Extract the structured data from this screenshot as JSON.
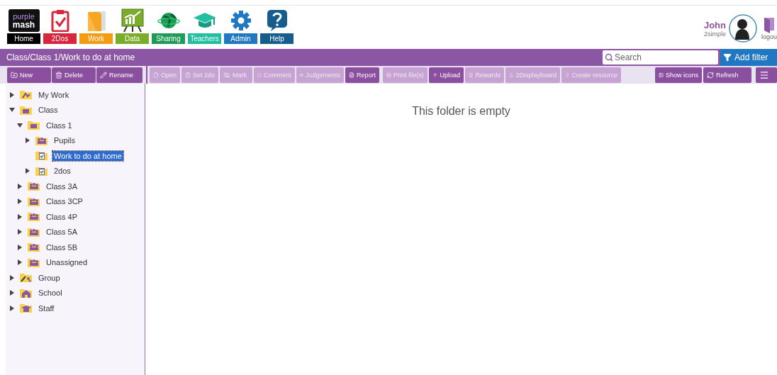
{
  "nav": [
    {
      "label": "Home",
      "color": "#000000"
    },
    {
      "label": "2Dos",
      "color": "#d7263d"
    },
    {
      "label": "Work",
      "color": "#f39c12"
    },
    {
      "label": "Data",
      "color": "#7cac2c"
    },
    {
      "label": "Sharing",
      "color": "#1e9b57"
    },
    {
      "label": "Teachers",
      "color": "#1fbf9f"
    },
    {
      "label": "Admin",
      "color": "#1f78c1"
    },
    {
      "label": "Help",
      "color": "#165d8d"
    }
  ],
  "logo": {
    "line1": "purple",
    "line2": "mash"
  },
  "user": {
    "name": "John",
    "school": "2simple",
    "logout": "logou"
  },
  "path": "Class/Class 1/Work to do at home",
  "search": {
    "placeholder": "Search"
  },
  "add_filter": "Add filter",
  "left_buttons": [
    {
      "label": "New",
      "disabled": false
    },
    {
      "label": "Delete",
      "disabled": false
    },
    {
      "label": "Rename",
      "disabled": false
    }
  ],
  "main_buttons": [
    {
      "label": "Open",
      "disabled": true
    },
    {
      "label": "Set 2do",
      "disabled": true
    },
    {
      "label": "Mark",
      "disabled": true
    },
    {
      "label": "Comment",
      "disabled": true
    },
    {
      "label": "Judgements",
      "disabled": true
    },
    {
      "label": "Report",
      "disabled": false
    }
  ],
  "file_buttons": [
    {
      "label": "Print file(s)",
      "disabled": true
    },
    {
      "label": "Upload",
      "disabled": false
    },
    {
      "label": "Rewards",
      "disabled": true
    },
    {
      "label": "2Displayboard",
      "disabled": true
    },
    {
      "label": "Create resource",
      "disabled": true
    }
  ],
  "view_buttons": [
    {
      "label": "Show icons",
      "disabled": false
    },
    {
      "label": "Refresh",
      "disabled": false
    }
  ],
  "tree": [
    {
      "label": "My Work",
      "kind": "work",
      "expandable": true,
      "expanded": false,
      "selected": false
    },
    {
      "label": "Class",
      "kind": "classes",
      "expandable": true,
      "expanded": true,
      "selected": false,
      "children": [
        {
          "label": "Class 1",
          "kind": "classes",
          "expandable": true,
          "expanded": true,
          "selected": false,
          "children": [
            {
              "label": "Pupils",
              "kind": "pupils",
              "expandable": true,
              "expanded": false,
              "selected": false
            },
            {
              "label": "Work to do at home",
              "kind": "todo",
              "expandable": false,
              "selected": true
            },
            {
              "label": "2dos",
              "kind": "todo",
              "expandable": true,
              "expanded": false,
              "selected": false
            }
          ]
        },
        {
          "label": "Class 3A",
          "kind": "pupils",
          "expandable": true,
          "expanded": false,
          "selected": false
        },
        {
          "label": "Class 3CP",
          "kind": "pupils",
          "expandable": true,
          "expanded": false,
          "selected": false
        },
        {
          "label": "Class 4P",
          "kind": "pupils",
          "expandable": true,
          "expanded": false,
          "selected": false
        },
        {
          "label": "Class 5A",
          "kind": "pupils",
          "expandable": true,
          "expanded": false,
          "selected": false
        },
        {
          "label": "Class 5B",
          "kind": "pupils",
          "expandable": true,
          "expanded": false,
          "selected": false
        },
        {
          "label": "Unassigned",
          "kind": "pupils",
          "expandable": true,
          "expanded": false,
          "selected": false
        }
      ]
    },
    {
      "label": "Group",
      "kind": "group",
      "expandable": true,
      "expanded": false,
      "selected": false
    },
    {
      "label": "School",
      "kind": "school",
      "expandable": true,
      "expanded": false,
      "selected": false
    },
    {
      "label": "Staff",
      "kind": "staff",
      "expandable": true,
      "expanded": false,
      "selected": false
    }
  ],
  "empty_message": "This folder is empty"
}
